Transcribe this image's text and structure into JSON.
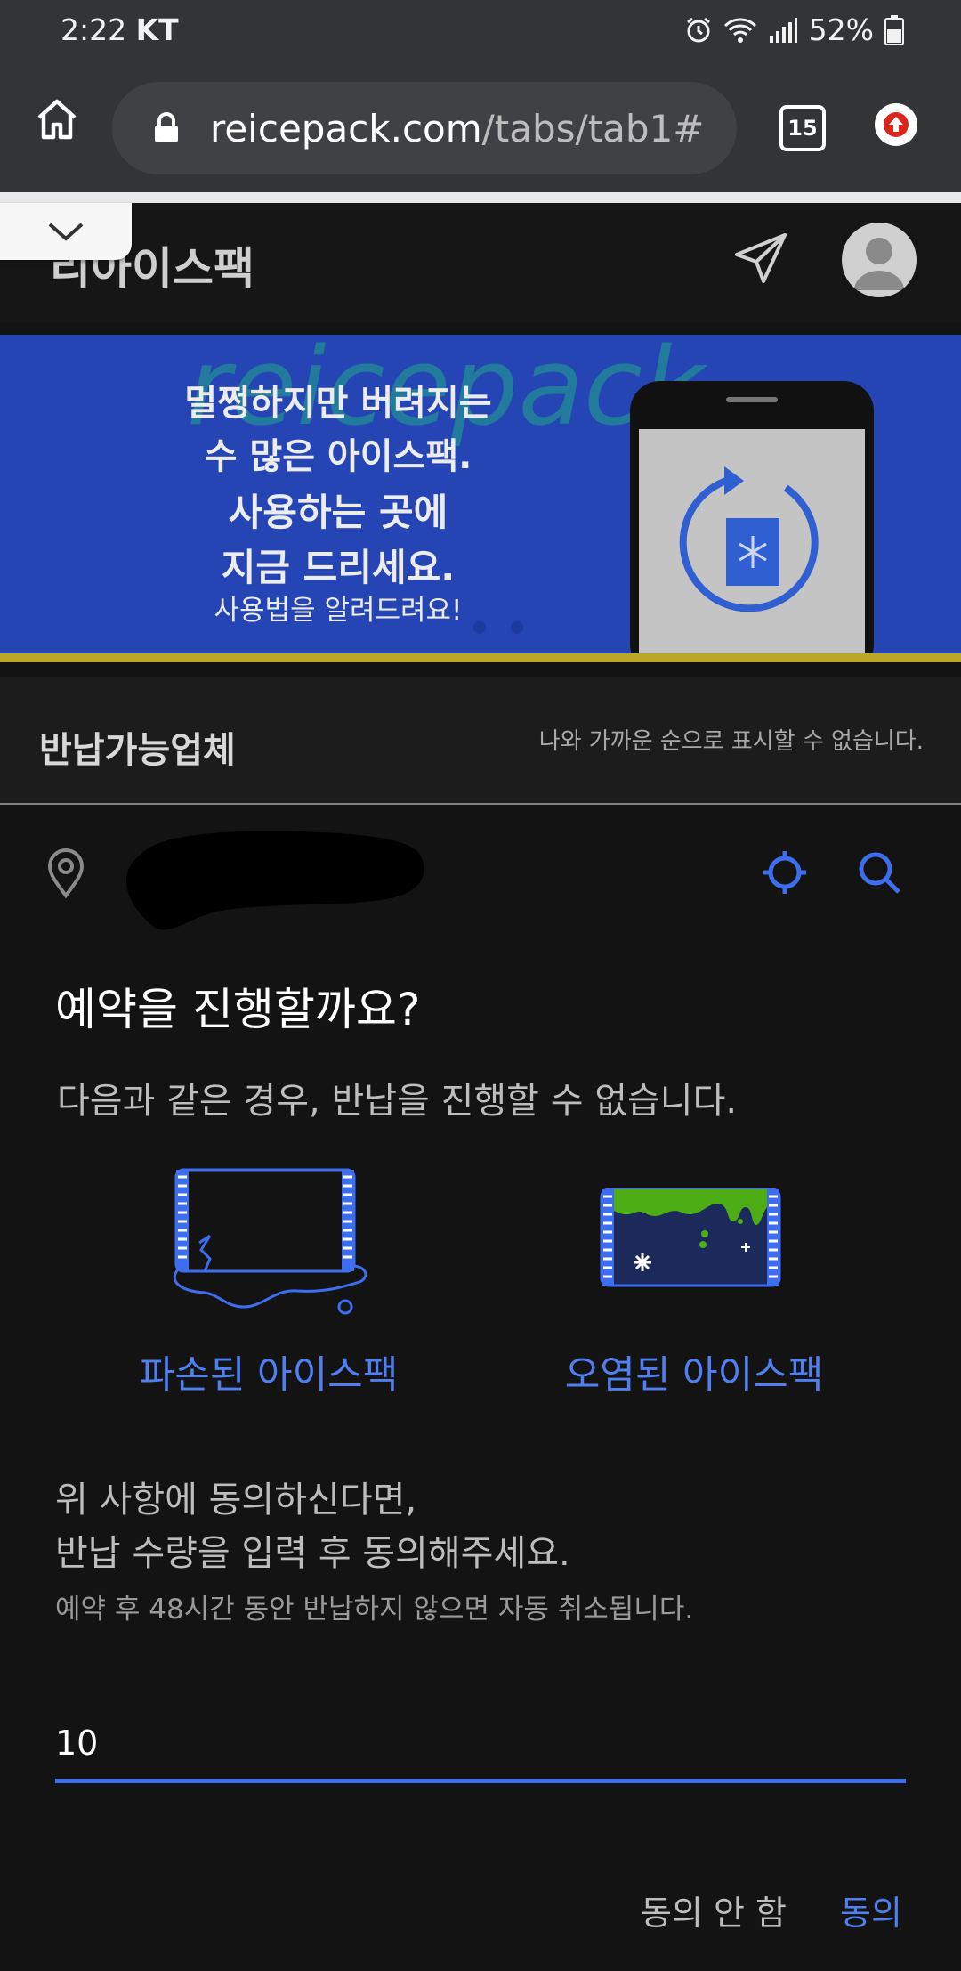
{
  "status_bar": {
    "time": "2:22",
    "carrier": "KT",
    "battery": "52%"
  },
  "browser": {
    "url_host": "reicepack.com",
    "url_path": "/tabs/tab1#",
    "tab_count": "15"
  },
  "app": {
    "title": "리아이스팩"
  },
  "banner": {
    "watermark": "reicepack",
    "line1": "멀쩡하지만 버려지는",
    "line2": "수 많은 아이스팩.",
    "line3": "사용하는 곳에",
    "line4": "지금 드리세요.",
    "line5": "사용법을 알려드려요!"
  },
  "returnable": {
    "title": "반납가능업체",
    "note": "나와 가까운 순으로 표시할 수 없습니다."
  },
  "dialog": {
    "title": "예약을 진행할까요?",
    "subtitle": "다음과 같은 경우, 반납을 진행할 수 없습니다.",
    "damaged_label": "파손된 아이스팩",
    "contaminated_label": "오염된 아이스팩",
    "agree_line1": "위 사항에 동의하신다면,",
    "agree_line2": "반납 수량을 입력 후 동의해주세요.",
    "agree_note": "예약 후 48시간 동안 반납하지 않으면 자동 취소됩니다.",
    "quantity_value": "10",
    "disagree_label": "동의 안 함",
    "agree_label": "동의"
  },
  "colors": {
    "accent": "#3d6ef0",
    "banner_bg": "#2545b4",
    "contamination": "#4cae14"
  }
}
